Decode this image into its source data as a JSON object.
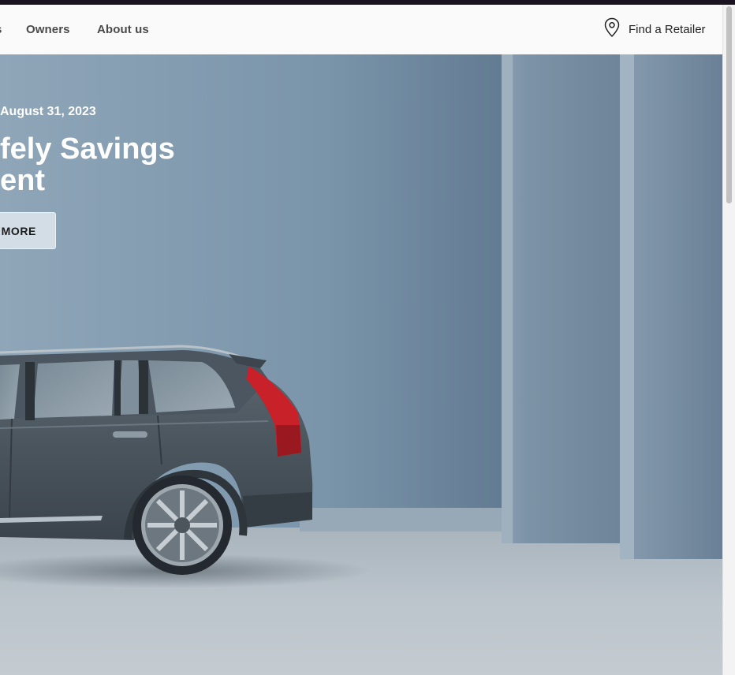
{
  "nav": {
    "cut_item": "s",
    "owners": "Owners",
    "about": "About us",
    "retailer": {
      "label": "Find a Retailer",
      "icon": "location-pin-icon"
    }
  },
  "hero": {
    "date_text": "August 31, 2023",
    "title_lines": [
      "fely Savings",
      "ent"
    ],
    "cta_label": "MORE"
  },
  "colors": {
    "nav_bg": "#fafafa",
    "hero_bg": "#7d97ad",
    "car_body": "#4a555e",
    "cta_bg": "#d3dde5",
    "taillight": "#c8212a"
  }
}
